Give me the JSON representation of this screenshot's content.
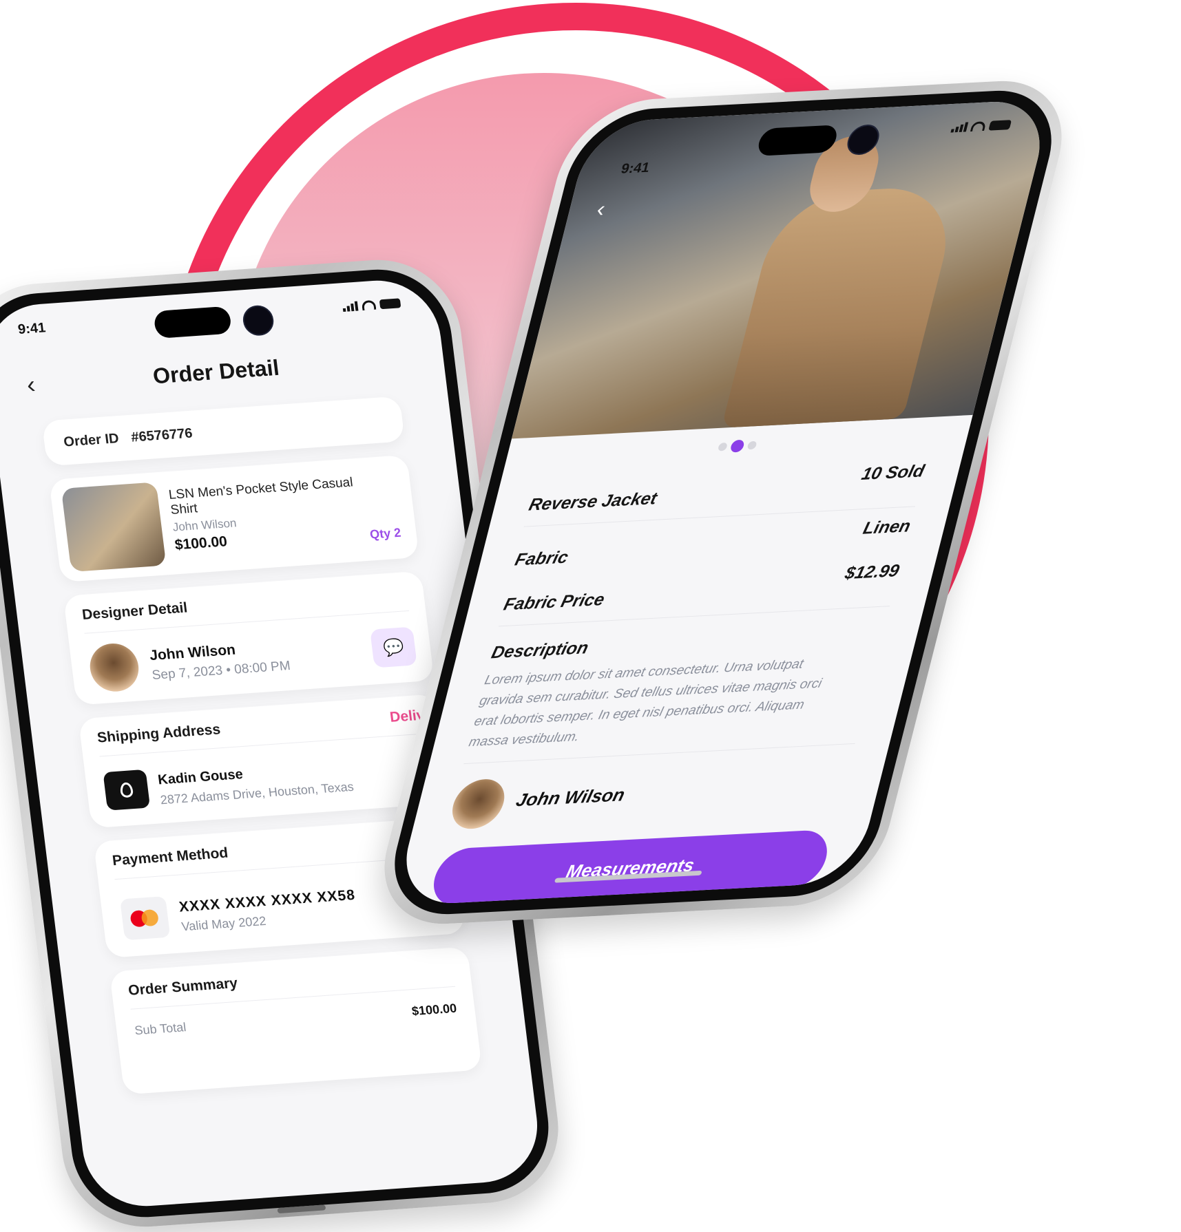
{
  "status": {
    "time": "9:41"
  },
  "order_detail": {
    "title": "Order Detail",
    "order_id_label": "Order ID",
    "order_id": "#6576776",
    "product": {
      "name": "LSN Men's Pocket Style Casual Shirt",
      "designer": "John Wilson",
      "price": "$100.00",
      "qty": "Qty 2"
    },
    "designer_detail": {
      "title": "Designer Detail",
      "name": "John Wilson",
      "datetime": "Sep 7, 2023 • 08:00 PM",
      "chat_icon": "chat-bubble-icon"
    },
    "shipping": {
      "title": "Shipping Address",
      "status": "Delivered",
      "name": "Kadin Gouse",
      "address": "2872 Adams Drive, Houston, Texas"
    },
    "payment": {
      "title": "Payment Method",
      "card_number": "XXXX XXXX XXXX XX58",
      "valid": "Valid May 2022",
      "brand_icon": "mastercard-icon"
    },
    "summary": {
      "title": "Order Summary",
      "subtotal_label": "Sub Total",
      "subtotal": "$100.00"
    }
  },
  "product_detail": {
    "name": "Reverse Jacket",
    "sold": "10 Sold",
    "fabric_label": "Fabric",
    "fabric": "Linen",
    "fabric_price_label": "Fabric Price",
    "fabric_price": "$12.99",
    "description_title": "Description",
    "description": "Lorem ipsum dolor sit amet consectetur. Urna volutpat gravida sem curabitur. Sed tellus ultrices vitae magnis orci erat lobortis semper. In eget nisl penatibus orci. Aliquam massa vestibulum.",
    "designer": "John Wilson",
    "cta": "Measurements",
    "carousel": {
      "count": 3,
      "active": 1
    }
  },
  "colors": {
    "accent": "#8b3fe8",
    "ring": "#f1305a",
    "delivered": "#ec4d8e"
  }
}
